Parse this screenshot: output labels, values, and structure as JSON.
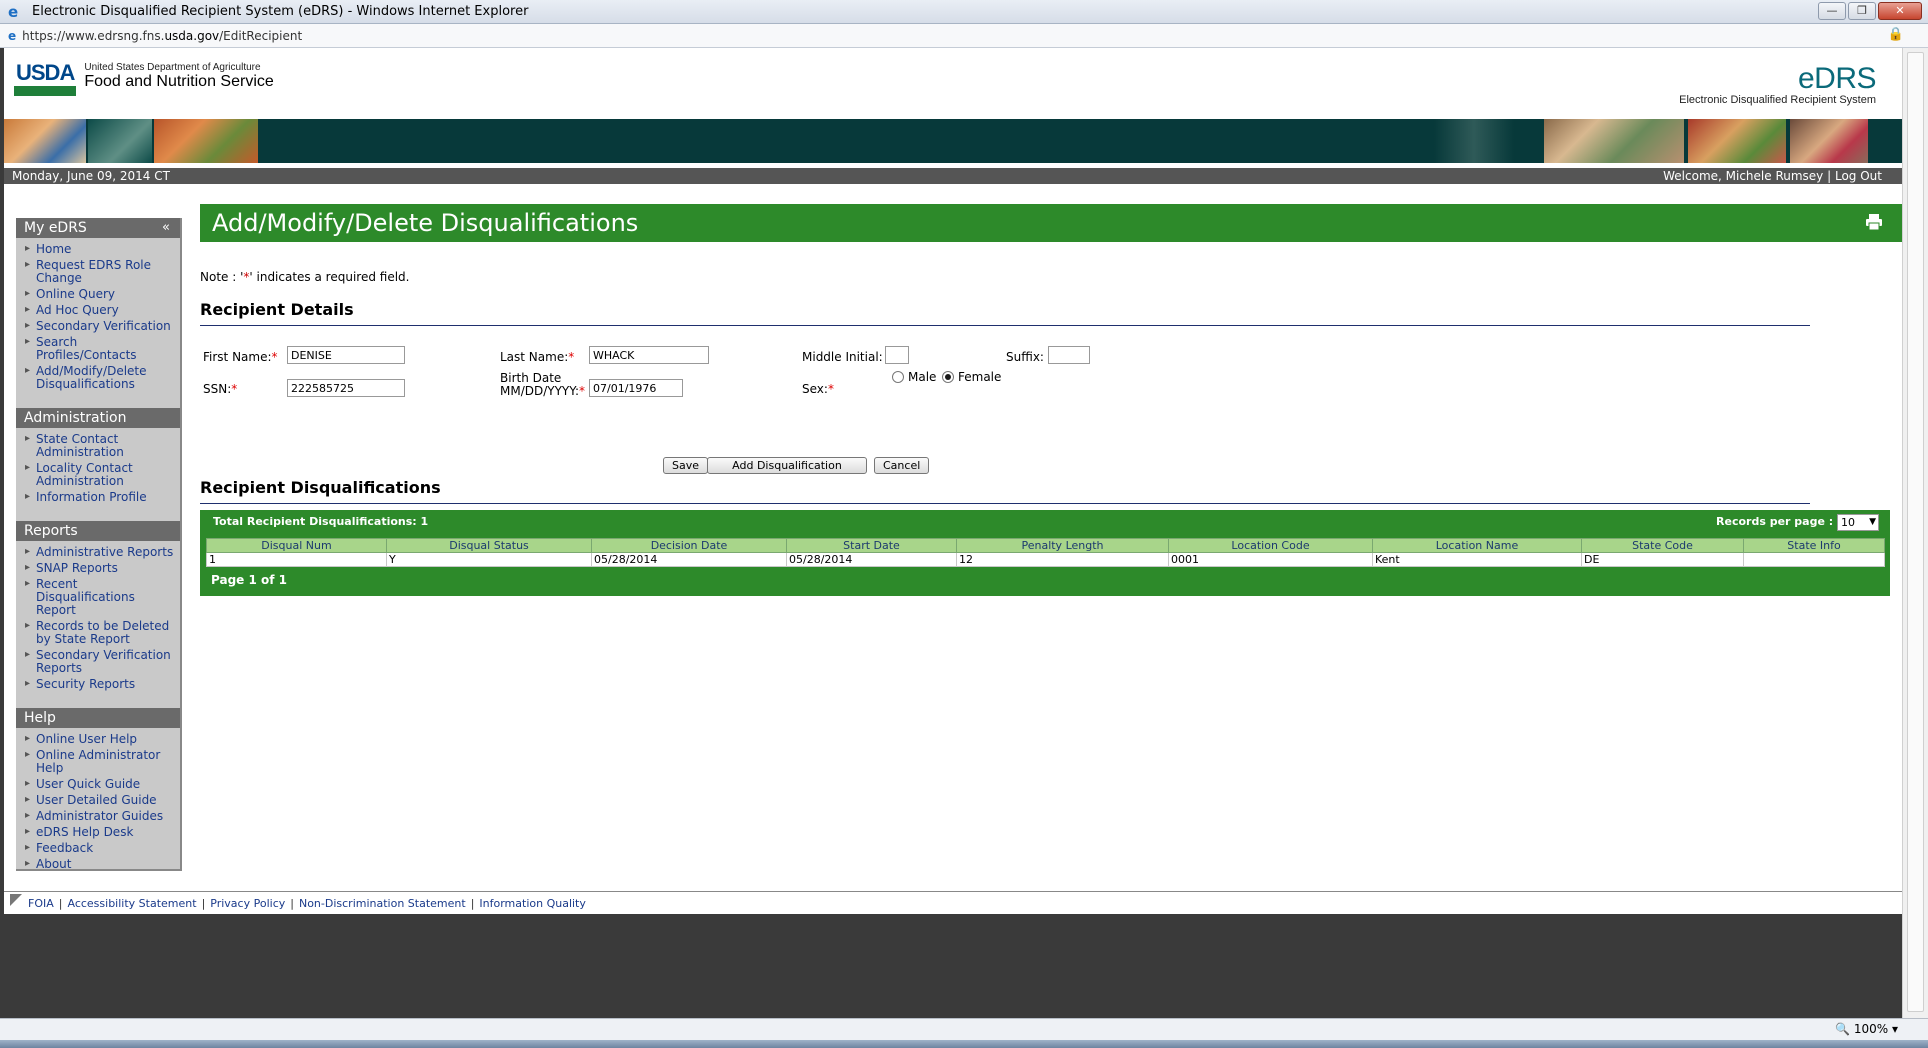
{
  "browser": {
    "title": "Electronic Disqualified Recipient System (eDRS) - Windows Internet Explorer",
    "url_prefix": "https://www.edrsng.fns.",
    "url_host": "usda.gov",
    "url_path": "/EditRecipient",
    "zoom": "100%"
  },
  "header": {
    "usda": "USDA",
    "dept": "United States Department of Agriculture",
    "agency": "Food and Nutrition Service",
    "edrs": "eDRS",
    "edrs_sub": "Electronic Disqualified Recipient System"
  },
  "infobar": {
    "date": "Monday, June 09, 2014 CT",
    "welcome": "Welcome, Michele Rumsey",
    "sep": "|",
    "logout": "Log Out"
  },
  "sidebar": {
    "myedrs": {
      "title": "My eDRS",
      "collapse": "«",
      "items": [
        "Home",
        "Request EDRS Role Change",
        "Online Query",
        "Ad Hoc Query",
        "Secondary Verification",
        "Search Profiles/Contacts",
        "Add/Modify/Delete Disqualifications"
      ]
    },
    "admin": {
      "title": "Administration",
      "items": [
        "State Contact Administration",
        "Locality Contact Administration",
        "Information Profile"
      ]
    },
    "reports": {
      "title": "Reports",
      "items": [
        "Administrative Reports",
        "SNAP Reports",
        "Recent Disqualifications Report",
        "Records to be Deleted by State Report",
        "Secondary Verification Reports",
        "Security Reports"
      ]
    },
    "help": {
      "title": "Help",
      "items": [
        "Online User Help",
        "Online Administrator Help",
        "User Quick Guide",
        "User Detailed Guide",
        "Administrator Guides",
        "eDRS Help Desk",
        "Feedback",
        "About"
      ]
    }
  },
  "page": {
    "title": "Add/Modify/Delete Disqualifications",
    "note_prefix": "Note : '",
    "note_star": "*",
    "note_suffix": "' indicates a required field."
  },
  "recipient": {
    "section_title": "Recipient Details",
    "first_name_label": "First Name:",
    "first_name": "DENISE",
    "last_name_label": "Last Name:",
    "last_name": "WHACK",
    "middle_initial_label": "Middle Initial:",
    "middle_initial": "",
    "suffix_label": "Suffix:",
    "suffix": "",
    "ssn_label": "SSN:",
    "ssn": "222585725",
    "birth_label_1": "Birth Date",
    "birth_label_2": "MM/DD/YYYY:",
    "birth_date": "07/01/1976",
    "sex_label": "Sex:",
    "sex_options": [
      "Male",
      "Female"
    ],
    "sex_selected": "Female",
    "req_mark": "*"
  },
  "buttons": {
    "save": "Save",
    "add": "Add Disqualification",
    "cancel": "Cancel"
  },
  "disquals": {
    "section_title": "Recipient Disqualifications",
    "total": "Total Recipient Disqualifications: 1",
    "rpp_label": "Records per page :",
    "rpp_value": "10",
    "columns": [
      "Disqual Num",
      "Disqual Status",
      "Decision Date",
      "Start Date",
      "Penalty Length",
      "Location Code",
      "Location Name",
      "State Code",
      "State Info"
    ],
    "rows": [
      [
        "1",
        "Y",
        "05/28/2014",
        "05/28/2014",
        "12",
        "0001",
        "Kent",
        "DE",
        ""
      ]
    ],
    "pager": "Page 1 of 1"
  },
  "footer": {
    "links": [
      "FOIA",
      "Accessibility Statement",
      "Privacy Policy",
      "Non-Discrimination Statement",
      "Information Quality"
    ]
  },
  "colors": {
    "title_green": "#2d8a2a",
    "banner_dark": "#07393a",
    "header_green": "#a8d58a",
    "link_blue": "#1a3a8a"
  }
}
